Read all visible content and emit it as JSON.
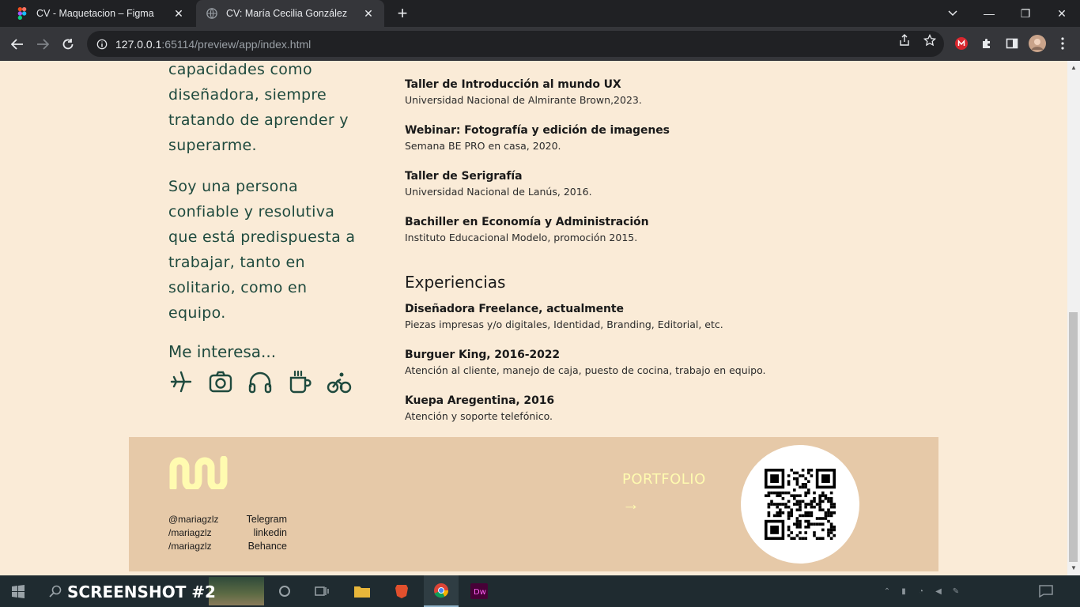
{
  "browser": {
    "tabs": [
      {
        "label": "CV - Maquetacion – Figma",
        "active": false
      },
      {
        "label": "CV: María Cecilia González",
        "active": true
      }
    ],
    "url_host": "127.0.0.1",
    "url_rest": ":65114/preview/app/index.html"
  },
  "profile": {
    "about_end": "capacidades como diseñadora, siempre tratando de aprender y superarme.",
    "about_2": "Soy una persona confiable y resolutiva que está predispuesta a trabajar, tanto en solitario, como en equipo.",
    "interests_title": "Me interesa...",
    "interests": [
      "airplane-icon",
      "camera-icon",
      "headphones-icon",
      "coffee-icon",
      "bicycle-icon"
    ]
  },
  "education": [
    {
      "title": "Taller de Introducción al mundo UX",
      "subtitle": "Universidad Nacional de Almirante Brown,2023."
    },
    {
      "title": "Webinar: Fotografía y edición de imagenes",
      "subtitle": "Semana BE PRO en casa, 2020."
    },
    {
      "title": "Taller de Serigrafía",
      "subtitle": "Universidad Nacional de Lanús, 2016."
    },
    {
      "title": "Bachiller en Economía y Administración",
      "subtitle": "Instituto Educacional Modelo, promoción 2015."
    }
  ],
  "experience_title": "Experiencias",
  "experience": [
    {
      "title": "Diseñadora Freelance, actualmente",
      "subtitle": "Piezas impresas y/o digitales, Identidad, Branding, Editorial, etc."
    },
    {
      "title": "Burguer King, 2016-2022",
      "subtitle": "Atención al cliente, manejo de caja, puesto de cocina, trabajo en equipo."
    },
    {
      "title": "Kuepa Aregentina, 2016",
      "subtitle": "Atención y soporte telefónico."
    }
  ],
  "footer": {
    "handles": [
      "@mariagzlz",
      "/mariagzlz",
      "/mariagzlz"
    ],
    "networks": [
      "Telegram",
      "linkedin",
      "Behance"
    ],
    "portfolio_label": "PORTFOLIO",
    "portfolio_arrow": "→"
  },
  "taskbar": {
    "watermark": "SCREENSHOT #2"
  },
  "colors": {
    "page_bg": "#faebd7",
    "text_green": "#1f4a3e",
    "footer_bg": "#e6c9a8",
    "accent_yellow": "#fffbb0"
  }
}
